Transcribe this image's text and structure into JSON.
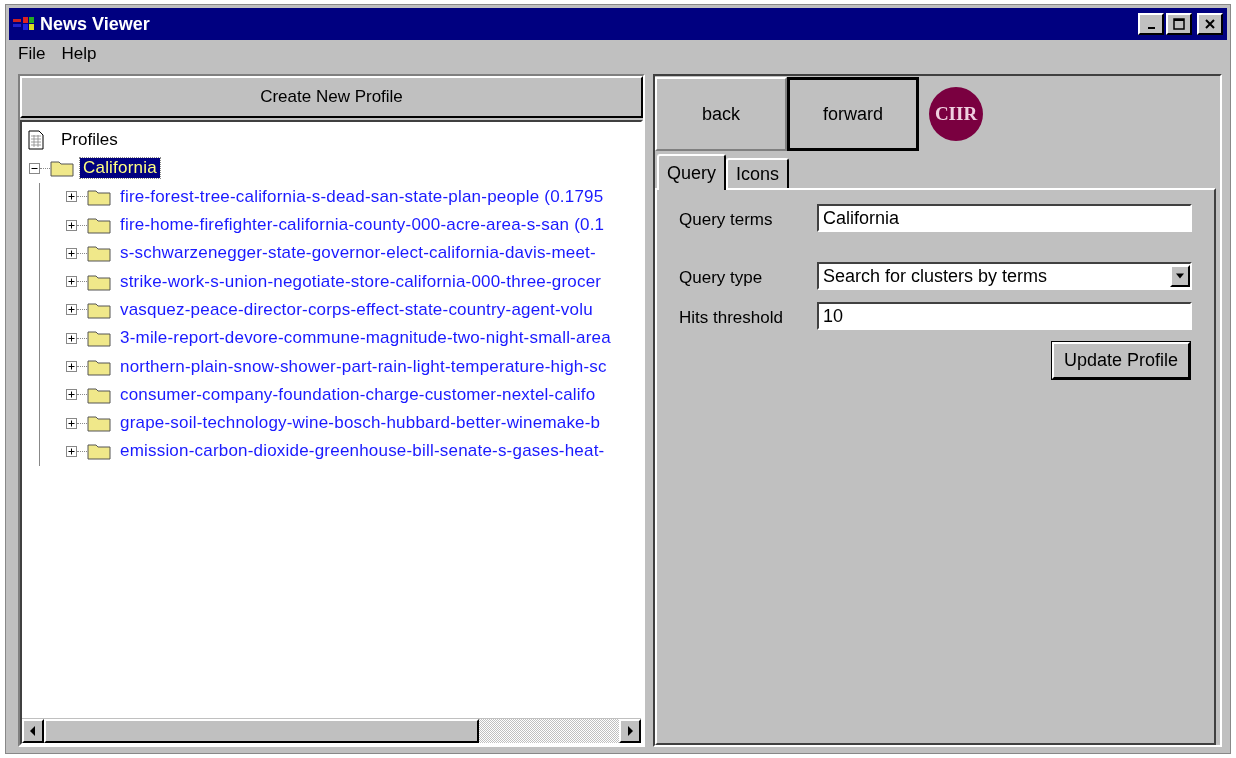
{
  "window": {
    "title": "News Viewer"
  },
  "menu": [
    "File",
    "Help"
  ],
  "create_button": "Create New Profile",
  "tree": {
    "label": "Profiles",
    "children": [
      {
        "label": "California",
        "selected": true,
        "expanded": true,
        "children": [
          {
            "label": "fire-forest-tree-california-s-dead-san-state-plan-people (0.1795",
            "selected": false,
            "expanded": false
          },
          {
            "label": "fire-home-firefighter-california-county-000-acre-area-s-san (0.1",
            "selected": false,
            "expanded": false
          },
          {
            "label": "s-schwarzenegger-state-governor-elect-california-davis-meet-",
            "selected": false,
            "expanded": false
          },
          {
            "label": "strike-work-s-union-negotiate-store-california-000-three-grocer",
            "selected": false,
            "expanded": false
          },
          {
            "label": "vasquez-peace-director-corps-effect-state-country-agent-volu",
            "selected": false,
            "expanded": false
          },
          {
            "label": "3-mile-report-devore-commune-magnitude-two-night-small-area",
            "selected": false,
            "expanded": false
          },
          {
            "label": "northern-plain-snow-shower-part-rain-light-temperature-high-sc",
            "selected": false,
            "expanded": false
          },
          {
            "label": "consumer-company-foundation-charge-customer-nextel-califo",
            "selected": false,
            "expanded": false
          },
          {
            "label": "grape-soil-technology-wine-bosch-hubbard-better-winemake-b",
            "selected": false,
            "expanded": false
          },
          {
            "label": "emission-carbon-dioxide-greenhouse-bill-senate-s-gases-heat-",
            "selected": false,
            "expanded": false
          }
        ]
      }
    ]
  },
  "nav_buttons": [
    {
      "label": "back",
      "focused": false
    },
    {
      "label": "forward",
      "focused": true
    }
  ],
  "logo": "CIIR",
  "tabs": [
    {
      "label": "Query",
      "selected": true
    },
    {
      "label": "Icons",
      "selected": false
    }
  ],
  "form": [
    {
      "kind": "text",
      "label": "Query terms",
      "value": "California"
    },
    {
      "kind": "select",
      "label": "Query type",
      "value": "Search for clusters by terms"
    },
    {
      "kind": "text",
      "label": "Hits threshold",
      "value": "10"
    }
  ],
  "update_button": "Update Profile"
}
